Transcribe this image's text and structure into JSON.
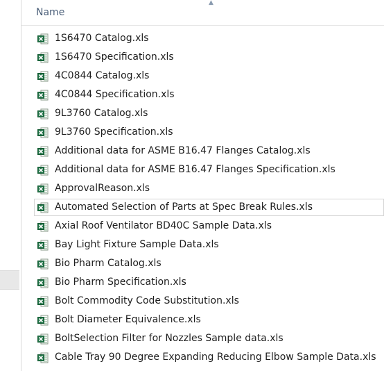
{
  "header": {
    "name_column": "Name"
  },
  "files": [
    {
      "name": "1S6470 Catalog.xls",
      "icon": "excel-file-icon",
      "selected": false
    },
    {
      "name": "1S6470 Specification.xls",
      "icon": "excel-file-icon",
      "selected": false
    },
    {
      "name": "4C0844 Catalog.xls",
      "icon": "excel-file-icon",
      "selected": false
    },
    {
      "name": "4C0844 Specification.xls",
      "icon": "excel-file-icon",
      "selected": false
    },
    {
      "name": "9L3760 Catalog.xls",
      "icon": "excel-file-icon",
      "selected": false
    },
    {
      "name": "9L3760 Specification.xls",
      "icon": "excel-file-icon",
      "selected": false
    },
    {
      "name": "Additional data for ASME B16.47 Flanges Catalog.xls",
      "icon": "excel-file-icon",
      "selected": false
    },
    {
      "name": "Additional data for ASME B16.47 Flanges Specification.xls",
      "icon": "excel-file-icon",
      "selected": false
    },
    {
      "name": "ApprovalReason.xls",
      "icon": "excel-file-icon",
      "selected": false
    },
    {
      "name": "Automated Selection of Parts at Spec Break Rules.xls",
      "icon": "excel-file-icon",
      "selected": true
    },
    {
      "name": "Axial Roof Ventilator BD40C Sample Data.xls",
      "icon": "excel-file-icon",
      "selected": false
    },
    {
      "name": "Bay Light Fixture Sample Data.xls",
      "icon": "excel-file-icon",
      "selected": false
    },
    {
      "name": "Bio Pharm Catalog.xls",
      "icon": "excel-file-icon",
      "selected": false
    },
    {
      "name": "Bio Pharm Specification.xls",
      "icon": "excel-file-icon",
      "selected": false
    },
    {
      "name": "Bolt Commodity Code Substitution.xls",
      "icon": "excel-file-icon",
      "selected": false
    },
    {
      "name": "Bolt Diameter Equivalence.xls",
      "icon": "excel-file-icon",
      "selected": false
    },
    {
      "name": "BoltSelection Filter for Nozzles Sample data.xls",
      "icon": "excel-file-icon",
      "selected": false
    },
    {
      "name": "Cable Tray 90 Degree Expanding Reducing Elbow Sample Data.xls",
      "icon": "excel-file-icon",
      "selected": false
    }
  ],
  "colors": {
    "excel_green": "#1e7145",
    "header_text": "#4c607a",
    "file_text": "#1e1e1e"
  }
}
